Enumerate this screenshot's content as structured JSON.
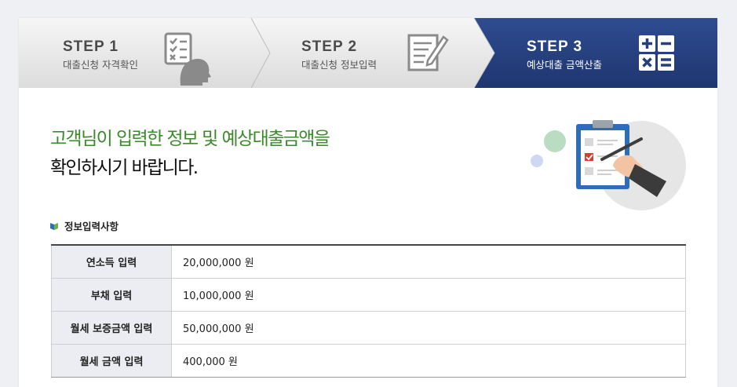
{
  "steps": [
    {
      "num": "STEP 1",
      "label": "대출신청 자격확인",
      "icon": "checklist-person-icon",
      "active": false
    },
    {
      "num": "STEP 2",
      "label": "대출신청 정보입력",
      "icon": "document-pen-icon",
      "active": false
    },
    {
      "num": "STEP 3",
      "label": "예상대출 금액산출",
      "icon": "calculator-icon",
      "active": true
    }
  ],
  "colors": {
    "active_step": "#253f7d",
    "headline_green": "#3b8a2a",
    "table_header_bg": "#ebedf2"
  },
  "headline": {
    "line1_green": "고객님이 입력한 정보 및 예상대출금액을",
    "line2": "확인하시기 바랍니다."
  },
  "section": {
    "title": "정보입력사항"
  },
  "table": {
    "rows": [
      {
        "label": "연소득 입력",
        "value": "20,000,000 원"
      },
      {
        "label": "부채 입력",
        "value": "10,000,000 원"
      },
      {
        "label": "월세 보증금액 입력",
        "value": "50,000,000 원"
      },
      {
        "label": "월세 금액 입력",
        "value": "400,000 원"
      }
    ]
  },
  "illustration": "clipboard-checklist-icon",
  "calculator_symbols": [
    "+",
    "−",
    "×",
    "="
  ]
}
